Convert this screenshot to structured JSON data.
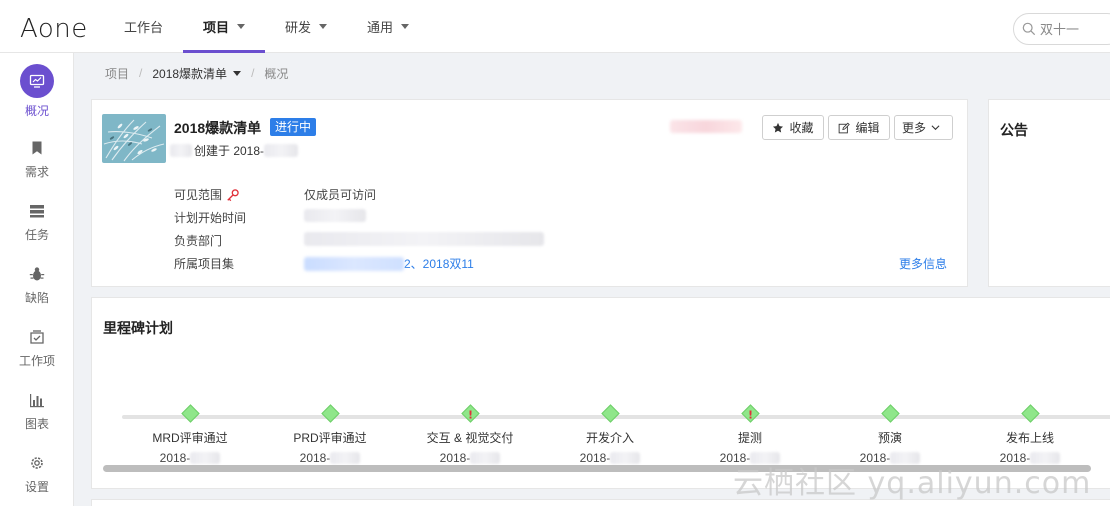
{
  "app": {
    "logo": "Aone"
  },
  "nav": {
    "items": [
      {
        "label": "工作台",
        "has_caret": false,
        "active": false
      },
      {
        "label": "项目",
        "has_caret": true,
        "active": true
      },
      {
        "label": "研发",
        "has_caret": true,
        "active": false
      },
      {
        "label": "通用",
        "has_caret": true,
        "active": false
      }
    ]
  },
  "search": {
    "placeholder": "双十一"
  },
  "sidebar": {
    "items": [
      {
        "label": "概况",
        "icon": "monitor-icon",
        "active": true
      },
      {
        "label": "需求",
        "icon": "bookmark-icon"
      },
      {
        "label": "任务",
        "icon": "task-list-icon"
      },
      {
        "label": "缺陷",
        "icon": "bug-icon"
      },
      {
        "label": "工作项",
        "icon": "work-item-icon"
      },
      {
        "label": "图表",
        "icon": "bar-chart-icon"
      },
      {
        "label": "设置",
        "icon": "gear-icon"
      }
    ]
  },
  "breadcrumb": {
    "root": "项目",
    "sep": "/",
    "project": "2018爆款清单",
    "page": "概况"
  },
  "project": {
    "title": "2018爆款清单",
    "status": "进行中",
    "created_label": "创建于 2018-",
    "buttons": {
      "favorite": "收藏",
      "edit": "编辑",
      "more": "更多"
    },
    "meta": {
      "visibility_label": "可见范围",
      "visibility_value": "仅成员可访问",
      "start_label": "计划开始时间",
      "dept_label": "负责部门",
      "collection_label": "所属项目集",
      "collection_value": "2、2018双11"
    },
    "more_info": "更多信息"
  },
  "notice": {
    "title": "公告"
  },
  "milestones": {
    "title": "里程碑计划",
    "items": [
      {
        "name": "MRD评审通过",
        "date": "2018-",
        "warn": false
      },
      {
        "name": "PRD评审通过",
        "date": "2018-",
        "warn": false
      },
      {
        "name": "交互 & 视觉交付",
        "date": "2018-",
        "warn": true
      },
      {
        "name": "开发介入",
        "date": "2018-",
        "warn": false
      },
      {
        "name": "提测",
        "date": "2018-",
        "warn": true
      },
      {
        "name": "预演",
        "date": "2018-",
        "warn": false
      },
      {
        "name": "发布上线",
        "date": "2018-",
        "warn": false
      }
    ]
  },
  "watermark": "云栖社区 yq.aliyun.com",
  "colors": {
    "accent": "#6b4fcf",
    "link": "#2d7ee8",
    "badge": "#2d7ee8",
    "milestone": "#8fe68a",
    "warn": "#e0303a"
  }
}
